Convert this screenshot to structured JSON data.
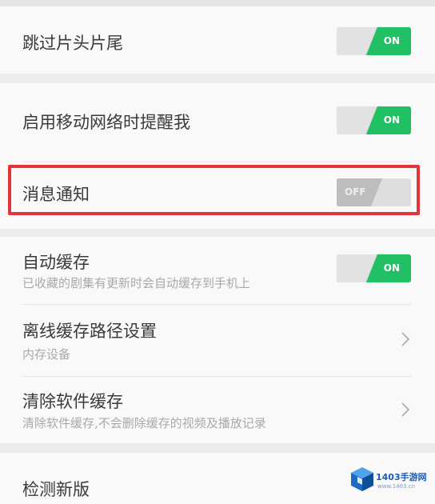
{
  "settings": {
    "skip_intro": {
      "title": "跳过片头片尾",
      "toggle_label": "ON",
      "state": "on"
    },
    "mobile_network_reminder": {
      "title": "启用移动网络时提醒我",
      "toggle_label": "ON",
      "state": "on"
    },
    "message_notification": {
      "title": "消息通知",
      "toggle_label": "OFF",
      "state": "off"
    },
    "auto_cache": {
      "title": "自动缓存",
      "subtitle": "已收藏的剧集有更新时会自动缓存到手机上",
      "toggle_label": "ON",
      "state": "on"
    },
    "offline_cache_path": {
      "title": "离线缓存路径设置",
      "subtitle": "内存设备"
    },
    "clear_cache": {
      "title": "清除软件缓存",
      "subtitle": "清除软件缓存,不会删除缓存的视频及播放记录"
    },
    "check_update": {
      "title": "检测新版"
    }
  },
  "watermark": {
    "text": "1403手游网",
    "url": "www.1403.cn"
  },
  "colors": {
    "accent_on": "#22c064",
    "toggle_off": "#bdbdbd",
    "highlight": "#e5333a",
    "background": "#ececec",
    "card": "#f9f9f9"
  },
  "icons": {
    "chevron": "chevron-right-icon",
    "watermark": "cube-logo-icon"
  }
}
